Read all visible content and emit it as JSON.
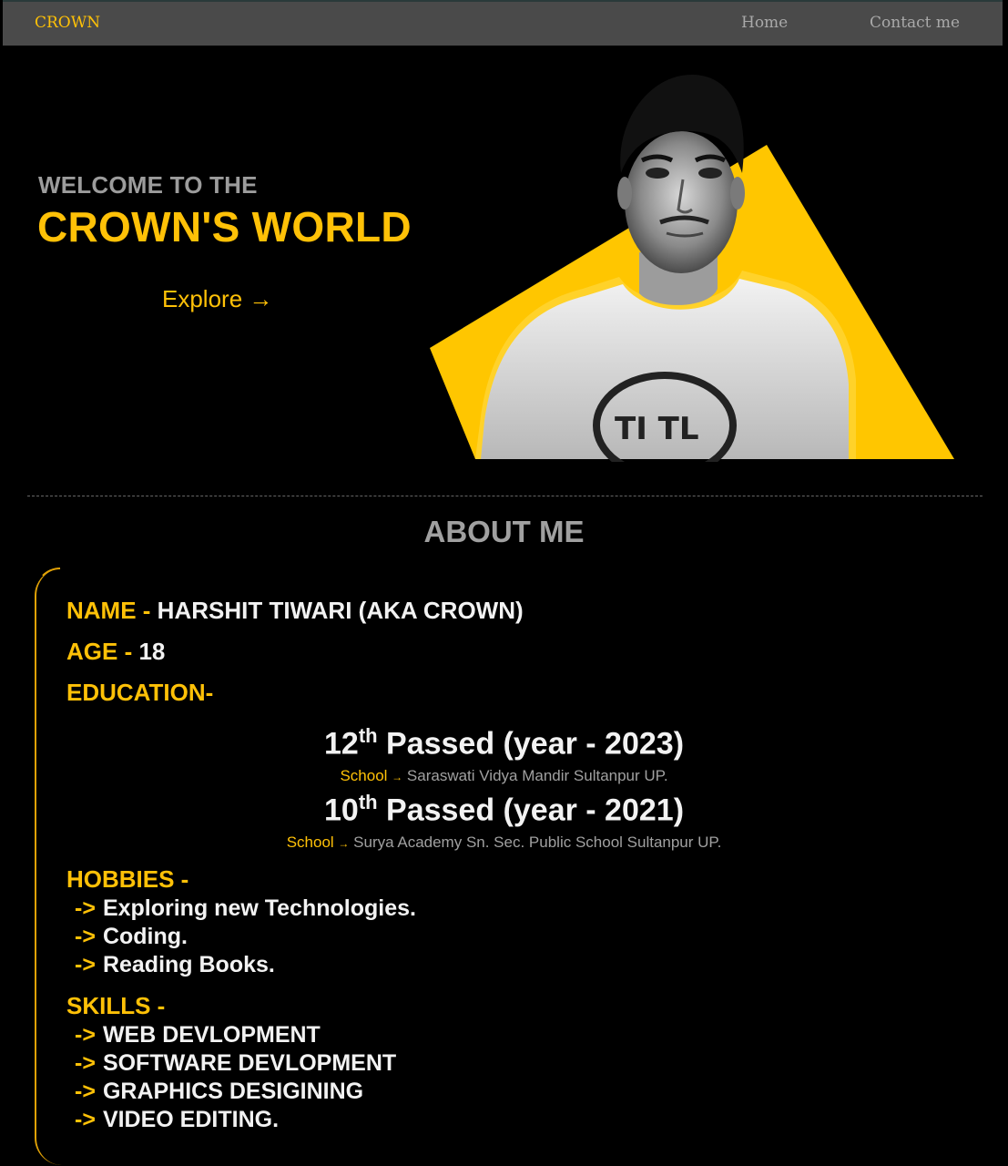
{
  "nav": {
    "brand": "CROWN",
    "links": [
      "Home",
      "Contact me"
    ]
  },
  "hero": {
    "welcome": "WELCOME TO THE",
    "title": "CROWN'S WORLD",
    "explore": "Explore →",
    "accent_color": "#ffc107"
  },
  "about": {
    "heading": "ABOUT ME",
    "name_label": "NAME -",
    "name_value": "HARSHIT TIWARI (AKA CROWN)",
    "age_label": "AGE -",
    "age_value": "18",
    "education_label": "EDUCATION-",
    "education": [
      {
        "grade": "12",
        "sup": "th",
        "passed": "Passed (year - 2023)",
        "school_label": "School",
        "arrow": "→",
        "school": "Saraswati Vidya Mandir Sultanpur UP."
      },
      {
        "grade": "10",
        "sup": "th",
        "passed": "Passed (year - 2021)",
        "school_label": "School",
        "arrow": "→",
        "school": "Surya Academy Sn. Sec. Public School Sultanpur UP."
      }
    ],
    "hobbies_label": "HOBBIES -",
    "hobbies": [
      "Exploring new Technologies.",
      "Coding.",
      "Reading Books."
    ],
    "skills_label": "SKILLS -",
    "skills": [
      "WEB DEVLOPMENT",
      "SOFTWARE DEVLOPMENT",
      "GRAPHICS DESIGINING",
      "VIDEO EDITING."
    ],
    "bullet": "->"
  }
}
